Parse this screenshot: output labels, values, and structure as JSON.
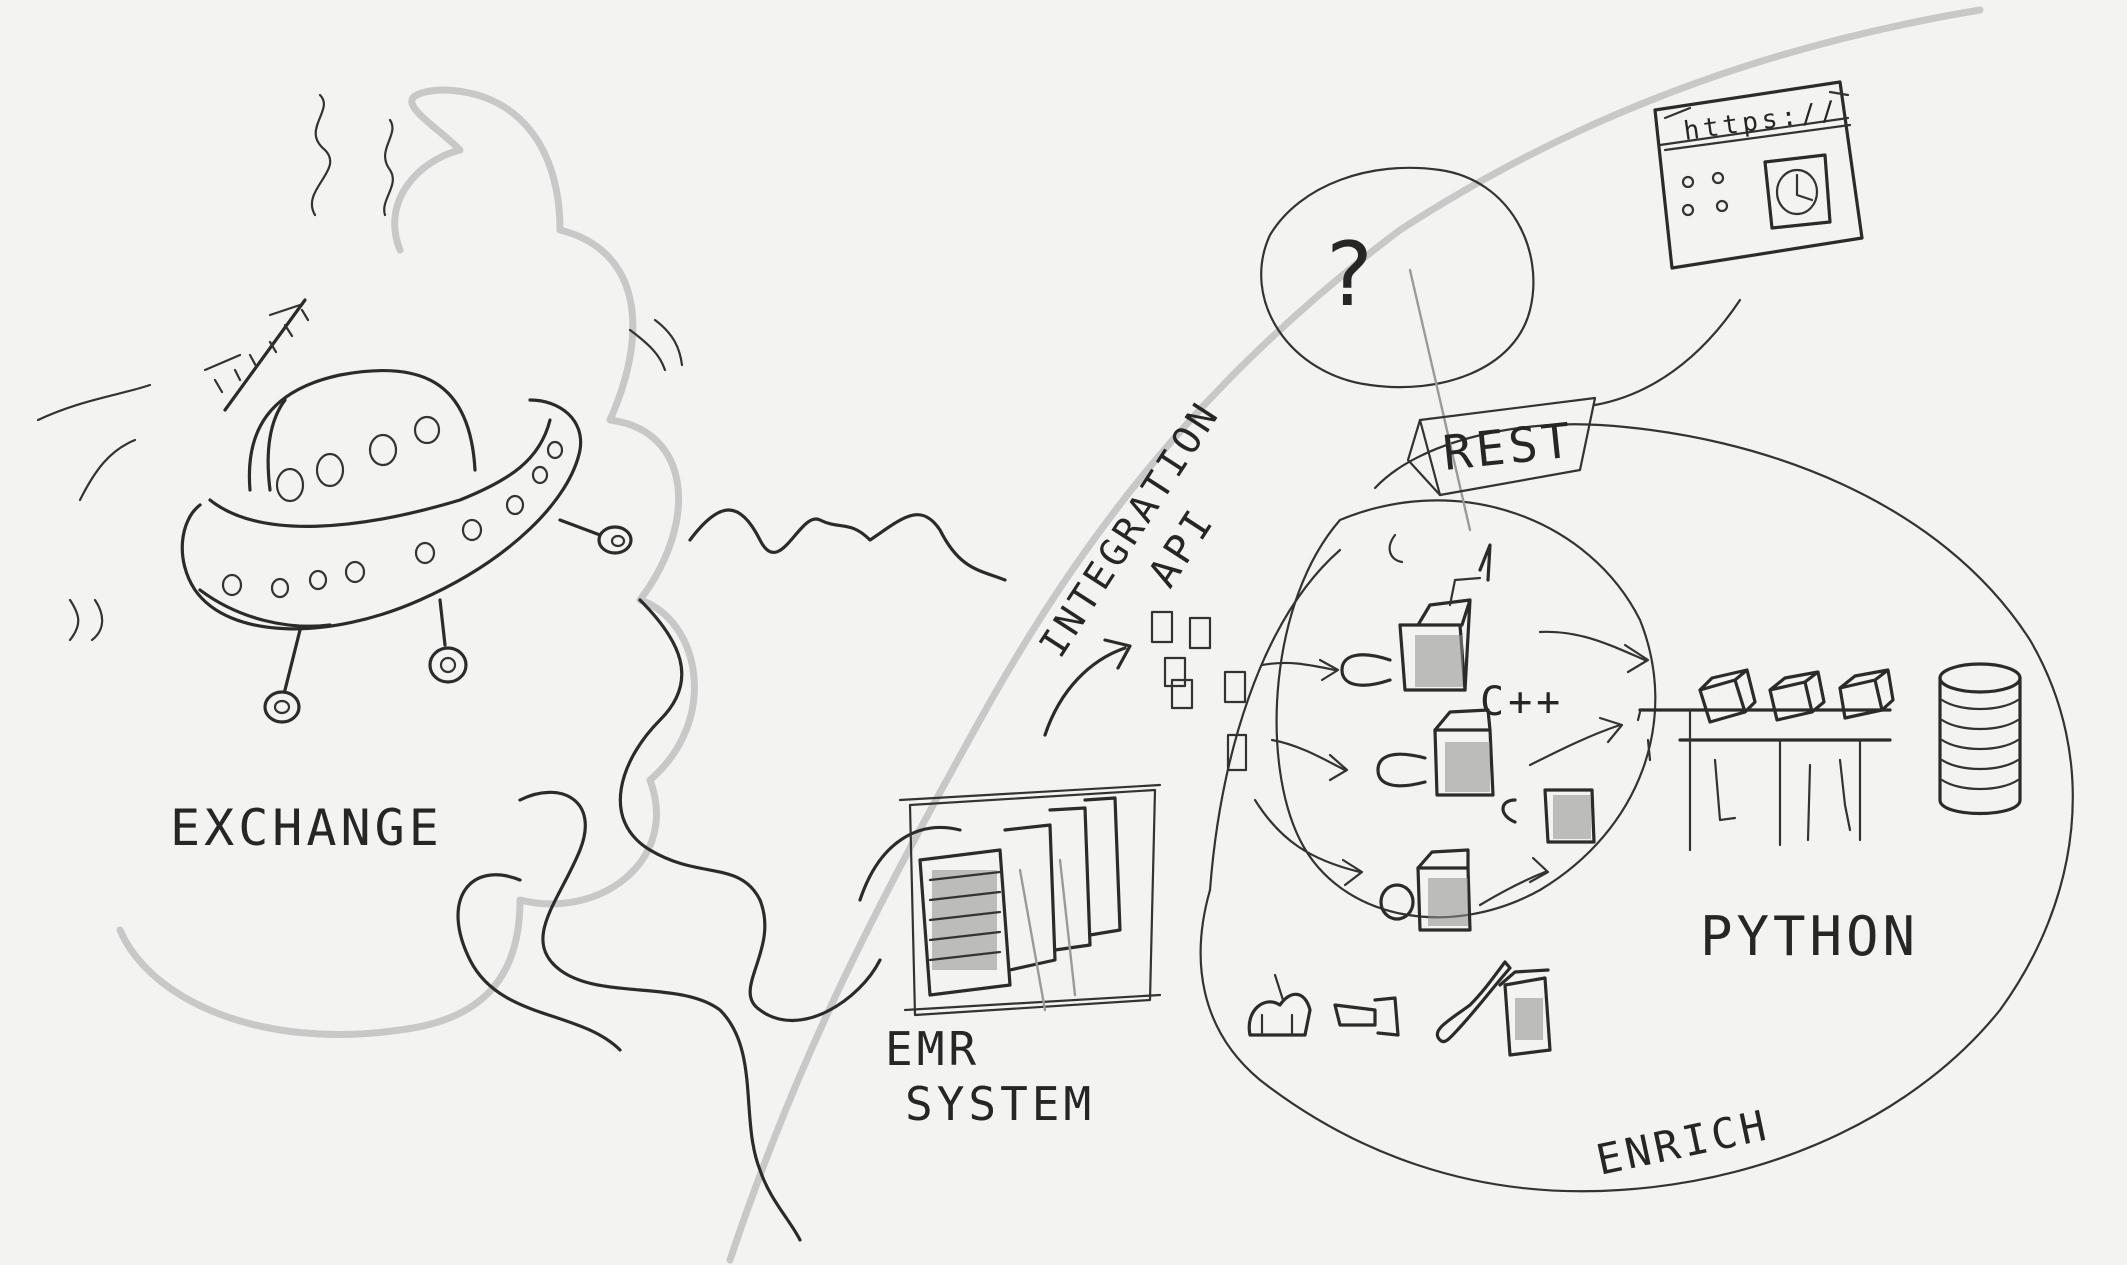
{
  "labels": {
    "exchange": "EXCHANGE",
    "emr_system_line1": "EMR",
    "emr_system_line2": "SYSTEM",
    "integration": "INTEGRATION",
    "api": "API",
    "rest": "REST",
    "question": "?",
    "cpp": "C++",
    "python": "PYTHON",
    "enrich": "ENRICH",
    "url": "https://"
  },
  "colors": {
    "paper": "#f3f3f2",
    "ink": "#2b2b2b",
    "pencil": "#b9b9b9"
  }
}
